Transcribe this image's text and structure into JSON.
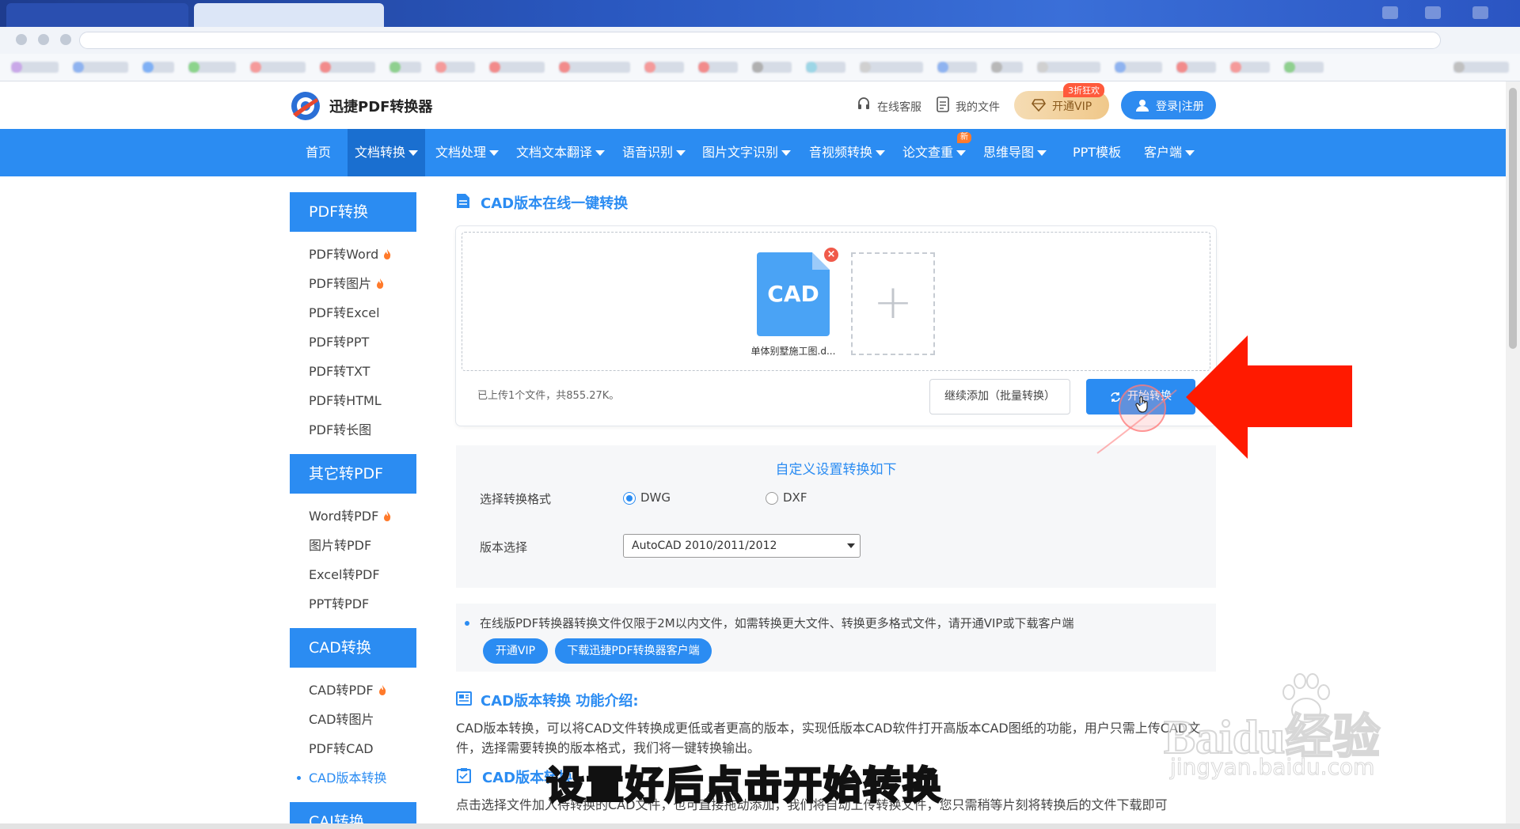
{
  "site": {
    "name": "迅捷PDF转换器",
    "header_links": [
      "在线客服",
      "我的文件"
    ],
    "vip_label": "开通VIP",
    "vip_badge": "3折狂欢",
    "login_label": "登录|注册"
  },
  "nav": {
    "items": [
      "首页",
      "文档转换",
      "文档处理",
      "文档文本翻译",
      "语音识别",
      "图片文字识别",
      "音视频转换",
      "论文查重",
      "思维导图",
      "PPT模板",
      "客户端"
    ],
    "new_badge": "新",
    "active_index": 1
  },
  "sidebar": {
    "groups": [
      {
        "title": "PDF转换",
        "items": [
          "PDF转Word",
          "PDF转图片",
          "PDF转Excel",
          "PDF转PPT",
          "PDF转TXT",
          "PDF转HTML",
          "PDF转长图"
        ]
      },
      {
        "title": "其它转PDF",
        "items": [
          "Word转PDF",
          "图片转PDF",
          "Excel转PDF",
          "PPT转PDF"
        ]
      },
      {
        "title": "CAD转换",
        "items": [
          "CAD转PDF",
          "CAD转图片",
          "PDF转CAD",
          "CAD版本转换"
        ]
      },
      {
        "title": "CAJ转换",
        "items": []
      }
    ],
    "active_item": "CAD版本转换"
  },
  "converter": {
    "title": "CAD版本在线一键转换",
    "file_type": "CAD",
    "file_name": "单体别墅施工图.d...",
    "add_symbol": "+",
    "remove_symbol": "×",
    "upload_status": "已上传1个文件，共855.27K。",
    "continue_label": "继续添加（批量转换）",
    "start_label": "开始转换"
  },
  "settings": {
    "title": "自定义设置转换如下",
    "format_label": "选择转换格式",
    "formats": [
      "DWG",
      "DXF"
    ],
    "selected_format": "DWG",
    "version_label": "版本选择",
    "version_value": "AutoCAD 2010/2011/2012"
  },
  "notice": {
    "text": "在线版PDF转换器转换文件仅限于2M以内文件，如需转换更大文件、转换更多格式文件，请开通VIP或下载客户端",
    "vip_button": "开通VIP",
    "download_button": "下载迅捷PDF转换器客户端"
  },
  "intro": {
    "title": "CAD版本转换 功能介绍:",
    "body": "CAD版本转换，可以将CAD文件转换成更低或者更高的版本，实现低版本CAD软件打开高版本CAD图纸的功能，用户只需上传CAD文件，选择需要转换的版本格式，我们将一键转换输出。"
  },
  "howto": {
    "title": "CAD版本转换",
    "body": "点击选择文件加入待转换的CAD文件，也可直接拖动添加，我们将自动上传转换文件，您只需稍等片刻将转换后的文件下载即可"
  },
  "overlay": {
    "subtitle": "设置好后点击开始转换",
    "watermark": "Baidu经验",
    "watermark_sub": "jingyan.baidu.com"
  },
  "colors": {
    "brand": "#2b8cf2",
    "accent_arrow": "#ff1a00"
  }
}
